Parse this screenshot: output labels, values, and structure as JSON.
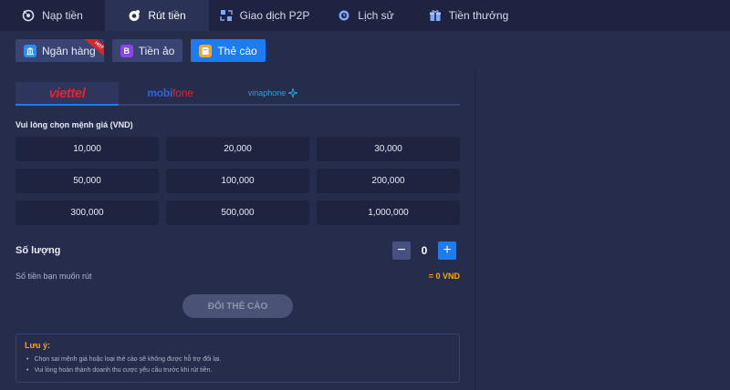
{
  "tabs": [
    {
      "label": "Nạp tiền",
      "icon": "coin-deposit-icon"
    },
    {
      "label": "Rút tiền",
      "icon": "coin-withdraw-icon",
      "active": true
    },
    {
      "label": "Giao dịch P2P",
      "icon": "p2p-transfer-icon"
    },
    {
      "label": "Lịch sử",
      "icon": "clock-history-icon"
    },
    {
      "label": "Tiền thưởng",
      "icon": "gift-icon"
    }
  ],
  "subtabs": [
    {
      "label": "Ngân hàng",
      "icon": "bank-icon",
      "badge": "HOT"
    },
    {
      "label": "Tiền ảo",
      "icon": "bitcoin-icon",
      "icon_glyph": "B"
    },
    {
      "label": "Thẻ cào",
      "icon": "scratch-card-icon",
      "active": true
    }
  ],
  "carriers": {
    "viettel": "viettel",
    "mobifone_a": "mobi",
    "mobifone_b": "fone",
    "vinaphone": "vinaphone"
  },
  "denom_label": "Vui lòng chọn mệnh giá (VND)",
  "denominations": [
    "10,000",
    "20,000",
    "30,000",
    "50,000",
    "100,000",
    "200,000",
    "300,000",
    "500,000",
    "1,000,000"
  ],
  "quantity": {
    "label": "Số lượng",
    "value": "0",
    "minus": "−",
    "plus": "+"
  },
  "amount": {
    "label": "Số tiền bạn muốn rút",
    "value": "= 0 VND"
  },
  "submit_label": "ĐỔI THẺ CÀO",
  "note": {
    "title": "Lưu ý:",
    "items": [
      "Chọn sai mệnh giá hoặc loại thẻ cào sẽ không được hỗ trợ đổi lại.",
      "Vui lòng hoàn thành doanh thu cược yêu cầu trước khi rút tiền."
    ]
  },
  "colors": {
    "accent": "#1c7cf2",
    "background": "#262d4c",
    "warning": "#f5a623",
    "viettel": "#e4232d",
    "mobifone": "#2c66d8",
    "vinaphone": "#1ba6e0"
  }
}
